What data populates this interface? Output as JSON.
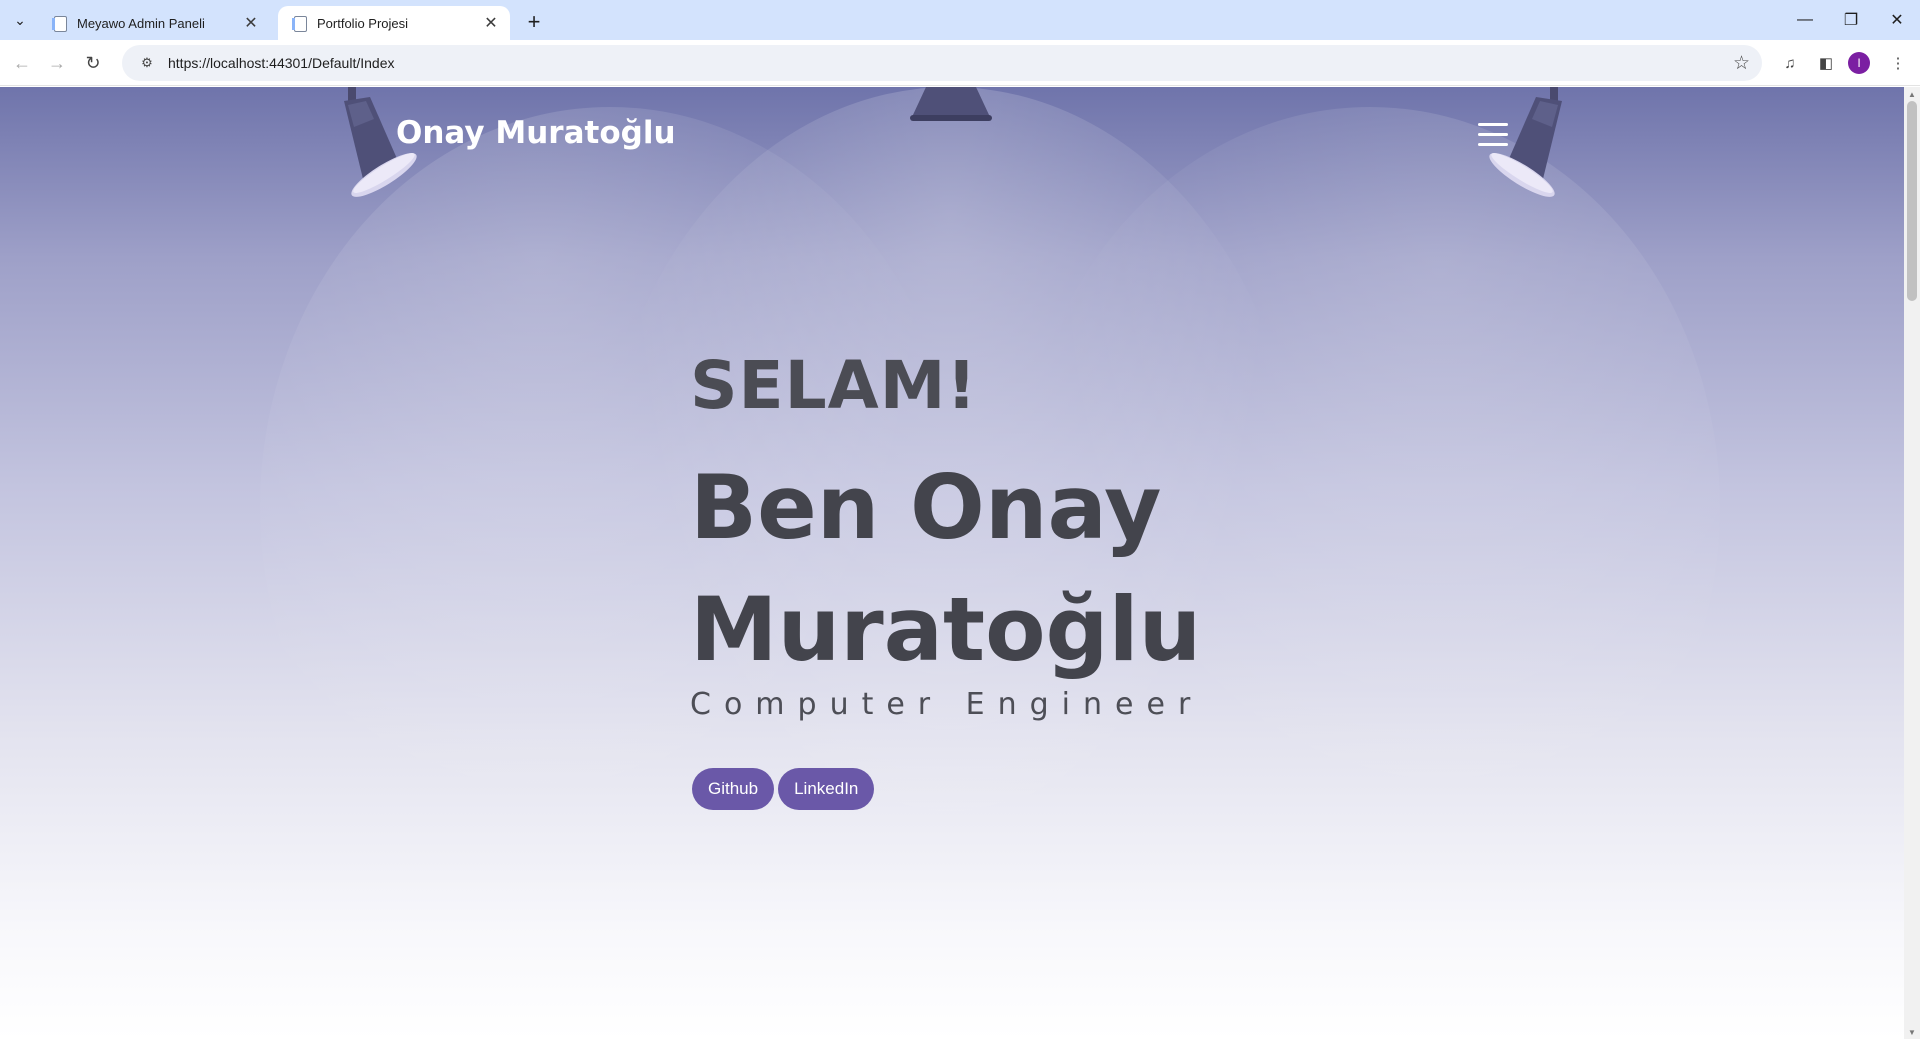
{
  "browser": {
    "tabs": [
      {
        "title": "Meyawo Admin Paneli",
        "active": false
      },
      {
        "title": "Portfolio Projesi",
        "active": true
      }
    ],
    "url": "https://localhost:44301/Default/Index",
    "profile_initial": "I",
    "glyphs": {
      "tab_search": "⌄",
      "tab_close": "✕",
      "new_tab": "+",
      "minimize": "—",
      "restore": "❐",
      "close": "✕",
      "back": "←",
      "forward": "→",
      "reload": "↻",
      "site_info": "⚙",
      "bookmark": "☆",
      "media": "♫",
      "side_panel": "◧",
      "menu": "⋮",
      "scroll_up": "▲",
      "scroll_down": "▼"
    }
  },
  "page": {
    "brand": "Onay Muratoğlu",
    "greeting": "SELAM!",
    "name_line1": "Ben Onay",
    "name_line2": "Muratoğlu",
    "role": "Computer Engineer",
    "buttons": {
      "github": "Github",
      "linkedin": "LinkedIn"
    }
  },
  "colors": {
    "tabbar": "#d3e3fd",
    "button": "#6a58a8",
    "heading": "#43444c",
    "profile": "#7b1fa2"
  }
}
